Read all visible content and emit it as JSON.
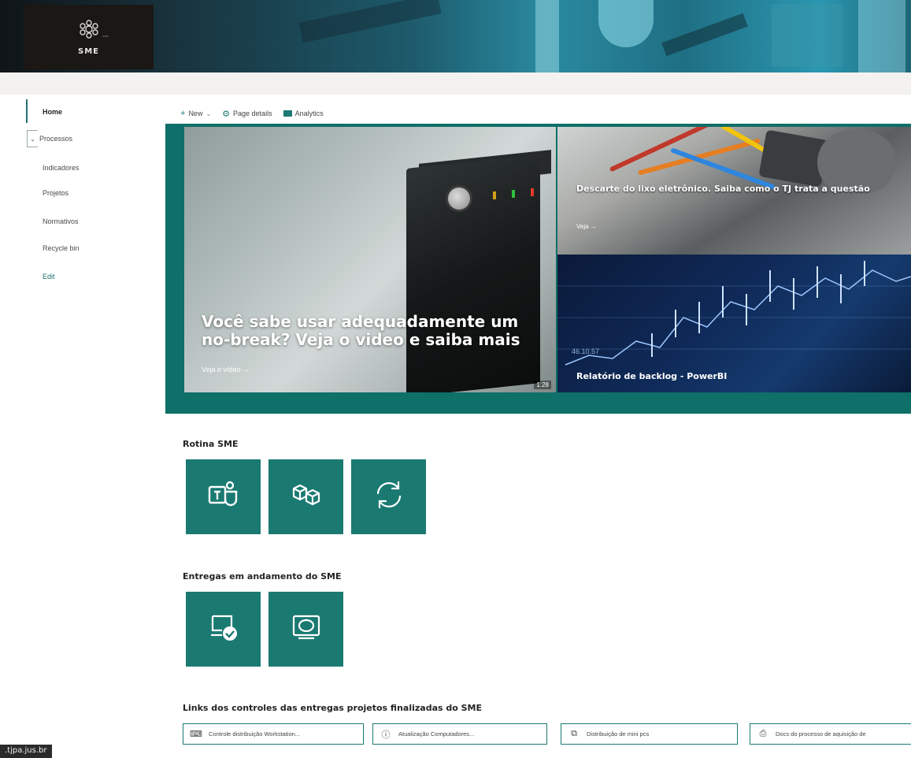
{
  "banner": {
    "logo_text": "SME"
  },
  "nav": {
    "items": [
      {
        "label": "Home"
      },
      {
        "label": "Processos"
      },
      {
        "label": "Indicadores"
      },
      {
        "label": "Projetos"
      },
      {
        "label": "Normativos"
      },
      {
        "label": "Recycle bin"
      },
      {
        "label": "Edit"
      }
    ],
    "toggle_glyph": "⌄"
  },
  "commandbar": {
    "new_label": "New",
    "page_details_label": "Page details",
    "analytics_label": "Analytics"
  },
  "hero": {
    "main": {
      "title": "Você sabe usar adequadamente um no-break? Veja o video e saiba mais",
      "link": "Veja o vídeo →",
      "duration": "1:28"
    },
    "top_right": {
      "title": "Descarte do lixo eletrônico. Saiba como o TJ trata a questão",
      "link": "Veja →"
    },
    "bottom_right": {
      "title": "Relatório de backlog - PowerBI",
      "chart_number": "46.10.57"
    }
  },
  "sections": {
    "rotina": {
      "title": "Rotina SME",
      "tiles": [
        {
          "icon": "teams-icon"
        },
        {
          "icon": "boxes-icon"
        },
        {
          "icon": "sync-icon"
        }
      ]
    },
    "entregas": {
      "title": "Entregas em andamento do SME",
      "tiles": [
        {
          "icon": "device-check-icon"
        },
        {
          "icon": "monitor-icon"
        }
      ]
    },
    "links": {
      "title": "Links dos controles das entregas projetos finalizadas do SME",
      "chips": [
        {
          "icon": "keyboard-icon",
          "label": "Controle distribuição Workstation..."
        },
        {
          "icon": "info-icon",
          "label": "Atualização Computadores..."
        },
        {
          "icon": "copy-icon",
          "label": "Distribuição de mini pcs"
        },
        {
          "icon": "printer-icon",
          "label": "Docs do processo de aquisição de"
        }
      ]
    }
  },
  "status_bar": {
    "url": ".tjpa.jus.br"
  },
  "colors": {
    "accent": "#1a7a72",
    "hero_bg": "#0f6f69"
  }
}
